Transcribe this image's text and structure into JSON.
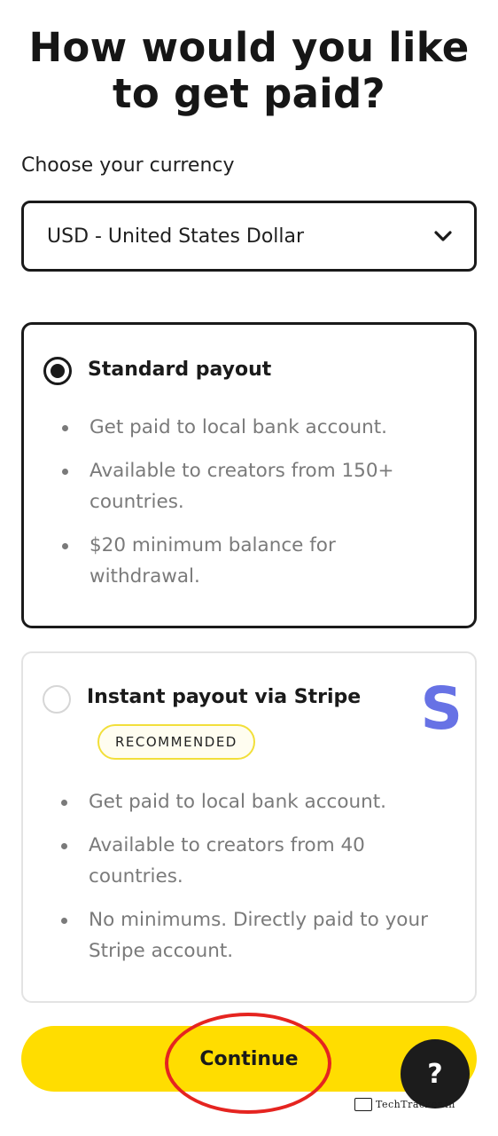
{
  "page": {
    "title": "How would you like to get paid?"
  },
  "currency": {
    "label": "Choose your currency",
    "selected": "USD - United States Dollar"
  },
  "options": [
    {
      "title": "Standard payout",
      "selected": true,
      "bullets": [
        "Get paid to local bank account.",
        "Available to creators from 150+ countries.",
        "$20 minimum balance for withdrawal."
      ]
    },
    {
      "title": "Instant payout via Stripe",
      "selected": false,
      "badge": "RECOMMENDED",
      "logo": "S",
      "bullets": [
        "Get paid to local bank account.",
        "Available to creators from 40 countries.",
        "No minimums. Directly paid to your Stripe account."
      ]
    }
  ],
  "actions": {
    "continue_label": "Continue",
    "help_label": "?"
  },
  "watermark": "TechTracker.in",
  "colors": {
    "accent": "#ffdd00",
    "stripe": "#6772e5",
    "annotation": "#e52420"
  },
  "icons": {
    "dropdown": "chevron-down-icon",
    "help": "question-icon"
  }
}
